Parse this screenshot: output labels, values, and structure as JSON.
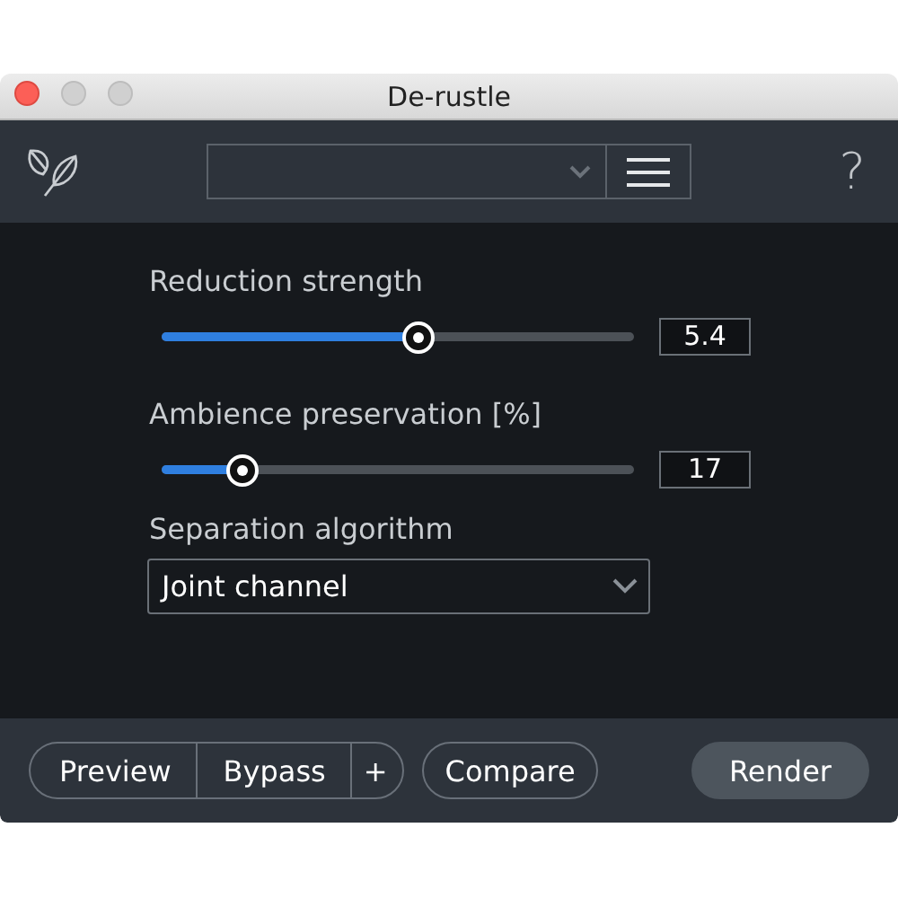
{
  "window": {
    "title": "De-rustle"
  },
  "toolbar": {
    "help": "?"
  },
  "sliders": [
    {
      "label": "Reduction strength",
      "level": 0.544,
      "value": "5.4"
    },
    {
      "label": "Ambience preservation [%]",
      "level": 0.17,
      "value": "17"
    }
  ],
  "algorithm": {
    "label": "Separation algorithm",
    "value": "Joint channel"
  },
  "footer": {
    "group": [
      "Preview",
      "Bypass",
      "+"
    ],
    "compare": "Compare",
    "render": "Render"
  }
}
